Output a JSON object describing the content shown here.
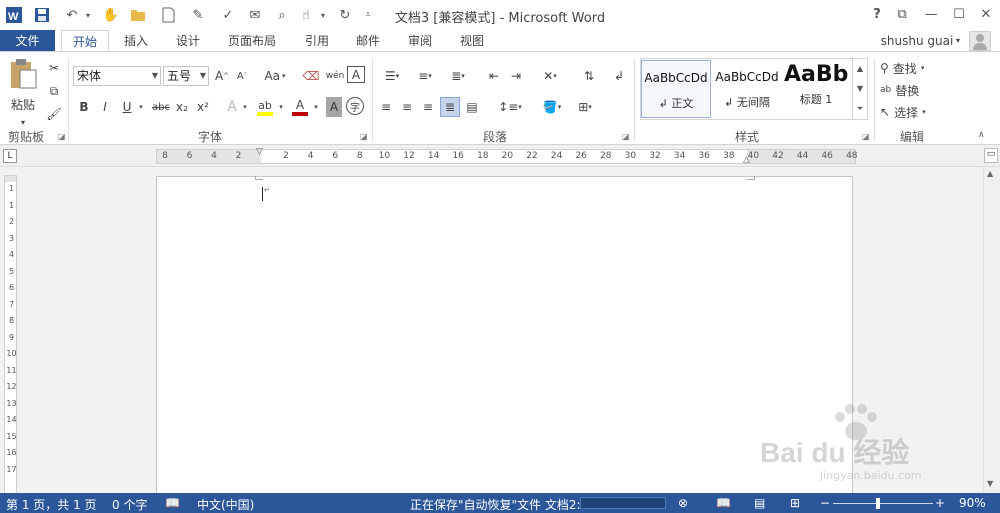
{
  "window": {
    "title": "文档3 [兼容模式] - Microsoft Word",
    "help": "?",
    "user": "shushu guai"
  },
  "tabs": [
    "文件",
    "开始",
    "插入",
    "设计",
    "页面布局",
    "引用",
    "邮件",
    "审阅",
    "视图"
  ],
  "ribbon": {
    "clipboard": {
      "paste_label": "粘贴",
      "group_label": "剪贴板"
    },
    "font": {
      "font_name": "宋体",
      "font_size": "五号",
      "grow": "A",
      "shrink": "A",
      "change_case": "Aa",
      "pinyin": "wén",
      "border_char": "A",
      "bold": "B",
      "italic": "I",
      "underline": "U",
      "strike": "abc",
      "subscript": "x₂",
      "superscript": "x²",
      "text_effect": "A",
      "font_color": "A",
      "char_shading": "A",
      "enclose": "字",
      "group_label": "字体"
    },
    "paragraph": {
      "group_label": "段落"
    },
    "styles": {
      "items": [
        {
          "preview": "AaBbCcDd",
          "name": "↲ 正文"
        },
        {
          "preview": "AaBbCcDd",
          "name": "↲ 无间隔"
        },
        {
          "preview": "AaBb",
          "name": "标题 1"
        }
      ],
      "group_label": "样式"
    },
    "editing": {
      "find": "查找",
      "replace": "替换",
      "select": "选择",
      "group_label": "编辑"
    }
  },
  "ruler": {
    "horizontal": [
      "8",
      "6",
      "4",
      "2",
      "2",
      "4",
      "6",
      "8",
      "10",
      "12",
      "14",
      "16",
      "18",
      "20",
      "22",
      "24",
      "26",
      "28",
      "30",
      "32",
      "34",
      "36",
      "38",
      "40",
      "42",
      "44",
      "46",
      "48"
    ],
    "vertical": [
      "1",
      "1",
      "2",
      "3",
      "4",
      "5",
      "6",
      "7",
      "8",
      "9",
      "10",
      "11",
      "12",
      "13",
      "14",
      "15",
      "16",
      "17"
    ]
  },
  "status": {
    "page": "第 1 页，共 1 页",
    "words": "0 个字",
    "language": "中文(中国)",
    "saving": "正在保存\"自动恢复\"文件 文档2:",
    "zoom": "90%",
    "zoom_minus": "−",
    "zoom_plus": "+"
  },
  "watermark": {
    "brand": "Bai du 经验",
    "url": "jingyan.baidu.com"
  },
  "colors": {
    "accent": "#2b579a",
    "highlight": "#ffff00",
    "font_color": "#c00000"
  }
}
